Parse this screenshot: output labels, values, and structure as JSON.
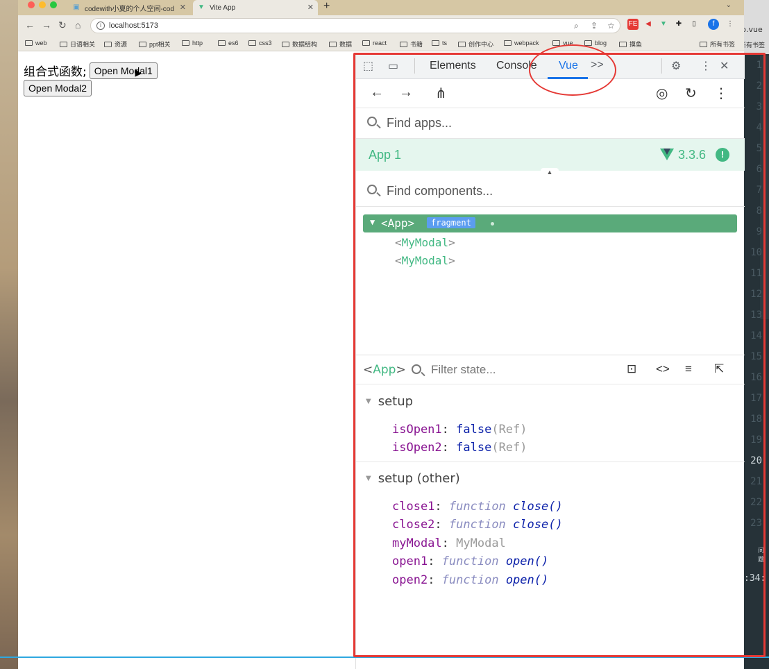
{
  "browser": {
    "tabs": [
      {
        "title": "codewith小夏的个人空间-cod",
        "active": false
      },
      {
        "title": "Vite App",
        "active": true
      }
    ],
    "new_tab": "+",
    "url": "localhost:5173",
    "bookmarks": [
      "web",
      "日语相关",
      "资源",
      "ppt相关",
      "http",
      "es6",
      "css3",
      "数据结构",
      "数据",
      "react",
      "书籍",
      "ts",
      "创作中心",
      "webpack",
      "vue",
      "blog",
      "摸鱼",
      "所有书签"
    ],
    "ext_labels": [
      "FE",
      "f"
    ]
  },
  "page": {
    "label": "组合式函数;",
    "button1": "Open Modal1",
    "button2": "Open Modal2"
  },
  "devtools": {
    "tabs": [
      "Elements",
      "Console",
      "Vue"
    ],
    "more": ">>",
    "find_apps_placeholder": "Find apps...",
    "app": {
      "name": "App 1",
      "version": "3.3.6",
      "badge": "!"
    },
    "find_components_placeholder": "Find components...",
    "tree": {
      "root_tag_open": "<",
      "root_name": "App",
      "root_tag_close": ">",
      "root_badge": "fragment",
      "children": [
        "MyModal",
        "MyModal"
      ]
    },
    "state": {
      "selected_component": "App",
      "filter_placeholder": "Filter state...",
      "sections": [
        {
          "title": "setup",
          "props": [
            {
              "key": "isOpen1",
              "value": "false",
              "suffix": "(Ref)"
            },
            {
              "key": "isOpen2",
              "value": "false",
              "suffix": "(Ref)"
            }
          ]
        },
        {
          "title": "setup (other)",
          "props": [
            {
              "key": "close1",
              "fn": "function",
              "name": "close()"
            },
            {
              "key": "close2",
              "fn": "function",
              "name": "close()"
            },
            {
              "key": "myModal",
              "plain": "MyModal"
            },
            {
              "key": "open1",
              "fn": "function",
              "name": "open()"
            },
            {
              "key": "open2",
              "fn": "function",
              "name": "open()"
            }
          ]
        }
      ]
    }
  },
  "editor": {
    "line_numbers": [
      "1",
      "2",
      "3",
      "4",
      "5",
      "6",
      "7",
      "8",
      "9",
      "10",
      "11",
      "12",
      "13",
      "14",
      "15",
      "16",
      "17",
      "18",
      "19",
      "20",
      "21",
      "22",
      "23"
    ],
    "active_line": "20",
    "tab_name": "p.vue",
    "bookmark_all": "所有书签",
    "side_text": "问题",
    "position": ":34:"
  },
  "colors": {
    "vue_green": "#42b883",
    "annotation_red": "#e53935",
    "devtools_blue": "#1a73e8"
  }
}
